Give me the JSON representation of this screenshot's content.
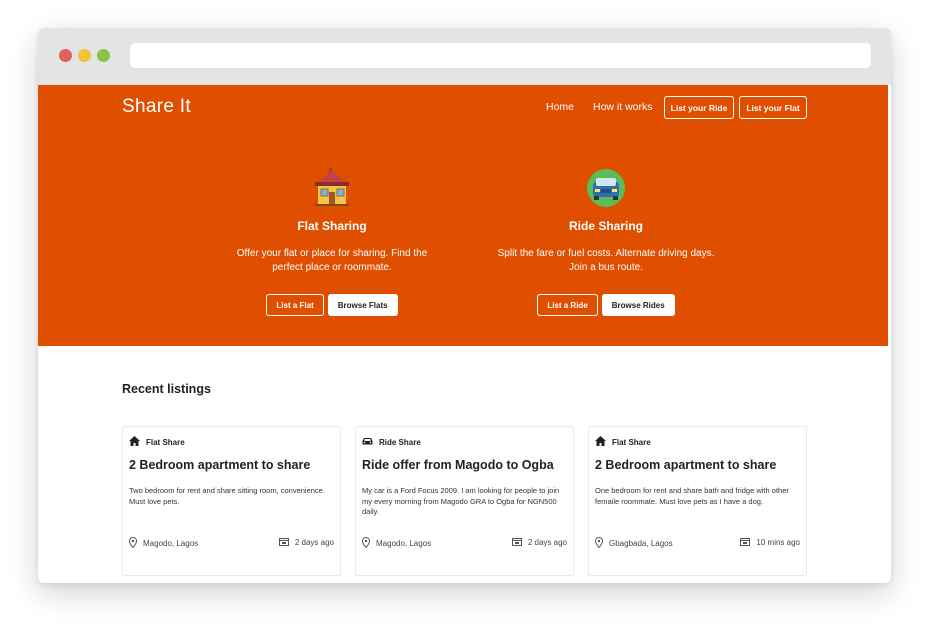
{
  "nav": {
    "brand": "Share It",
    "links": [
      "Home",
      "How it works"
    ],
    "buttons": [
      "List your Ride",
      "List your Flat"
    ]
  },
  "hero": {
    "flat": {
      "icon": "house-icon",
      "title": "Flat Sharing",
      "desc": "Offer your flat or place for sharing. Find the perfect place or roommate.",
      "btn_outline": "List a Flat",
      "btn_solid": "Browse Flats"
    },
    "ride": {
      "icon": "car-icon",
      "title": "Ride Sharing",
      "desc": "Split the fare or fuel costs. Alternate driving days. Join a bus route.",
      "btn_outline": "List a Ride",
      "btn_solid": "Browse Rides"
    }
  },
  "listings": {
    "title": "Recent listings",
    "cards": [
      {
        "type": "Flat Share",
        "type_icon": "home-icon",
        "title": "2 Bedroom apartment to share",
        "desc": "Two bedroom for rent and share sitting room, convenience. Must love pets.",
        "location": "Magodo, Lagos",
        "time": "2 days ago"
      },
      {
        "type": "Ride Share",
        "type_icon": "car-icon",
        "title": "Ride offer from Magodo to Ogba",
        "desc": "My car is a Ford Focus 2009. I am looking for people to join my every morning from Magodo GRA to Ogba for NGN500 daily.",
        "location": "Magodo, Lagos",
        "time": "2 days ago"
      },
      {
        "type": "Flat Share",
        "type_icon": "home-icon",
        "title": "2 Bedroom apartment to share",
        "desc": "One bedroom for rent and share bath and fridge with other femaile roommate. Must love pets as I have a dog.",
        "location": "Gbagbada, Lagos",
        "time": "10 mins ago"
      }
    ]
  },
  "colors": {
    "accent": "#e04e00",
    "chrome": "#e4e4e4"
  }
}
